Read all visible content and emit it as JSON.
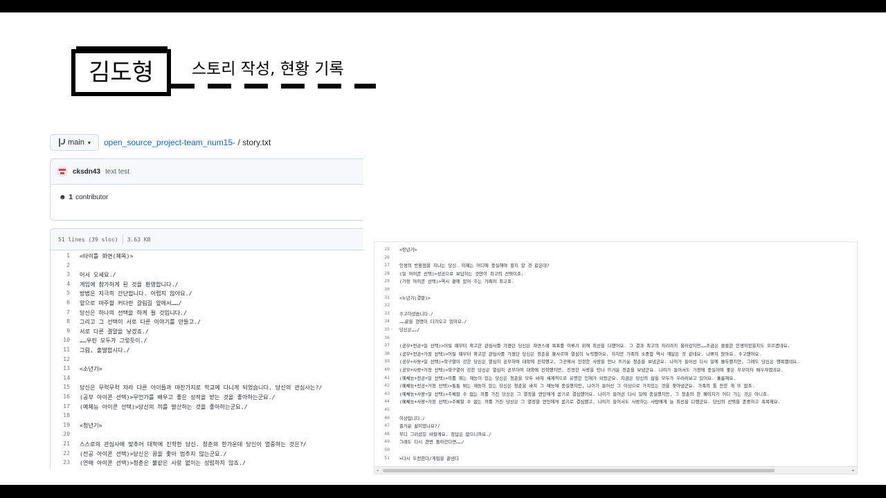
{
  "header": {
    "name": "김도형",
    "subtitle": "스토리 작성, 현황 기록"
  },
  "github": {
    "branch": "main",
    "repo_link": "open_source_project-team_num15-",
    "separator": "/",
    "file_name": "story.txt",
    "commit": {
      "author": "cksdn43",
      "message": "text test"
    },
    "contributors": {
      "count": "1",
      "label": "contributor"
    },
    "file_info": {
      "lines": "51 lines (39 sloc)",
      "size": "3.63 KB"
    },
    "code": [
      {
        "n": "1",
        "t": "<타이틀 화면(제목)>"
      },
      {
        "n": "2",
        "t": ""
      },
      {
        "n": "3",
        "t": "어서 오세요./"
      },
      {
        "n": "4",
        "t": "게임에 참가하게 된 것을 환영합니다./"
      },
      {
        "n": "5",
        "t": "방법은 지극히 간단합니다. 어렵지 않아요./"
      },
      {
        "n": "6",
        "t": "앞으로 마주할 커다란 갈림길 앞에서……/"
      },
      {
        "n": "7",
        "t": "당신은 하나의 선택을 하게 될 것입니다./"
      },
      {
        "n": "8",
        "t": "그리고 그 선택이 서로 다른 이야기를 만들고./"
      },
      {
        "n": "9",
        "t": "서로 다른 결말을 낳겠죠./"
      },
      {
        "n": "10",
        "t": "……우린 모두가 그렇듯이./"
      },
      {
        "n": "11",
        "t": "그럼, 출발합시다./"
      },
      {
        "n": "12",
        "t": ""
      },
      {
        "n": "13",
        "t": "<소년기>"
      },
      {
        "n": "14",
        "t": ""
      },
      {
        "n": "15",
        "t": "당신은 무럭무럭 자라 다른 아이들과 마찬가지로 학교에 다니게 되었습니다. 당신의 관심사는?/"
      },
      {
        "n": "16",
        "t": "(공부 아이콘 선택)>무언가를 배우고 좋은 성적을 받는 것을 좋아하는군요./"
      },
      {
        "n": "17",
        "t": "(예체능 아이콘 선택)>당신의 끼를 발산하는 것을 좋아하는군요./"
      },
      {
        "n": "18",
        "t": ""
      },
      {
        "n": "19",
        "t": "<청년기>"
      },
      {
        "n": "20",
        "t": ""
      },
      {
        "n": "21",
        "t": "스스로의 관심사에 맞추어 대학에 진학한 당신. 청춘의 한가운데 당신이 열중하는 것은?/"
      },
      {
        "n": "22",
        "t": "(전공 아이콘 선택)>당신은 꿈을 좇아 멈추지 않는군요./"
      },
      {
        "n": "23",
        "t": "(연애 아이콘 선택)>청춘은 불같은 사랑 없이는 성립하지 않죠./"
      }
    ]
  },
  "second_view": {
    "code": [
      {
        "n": "25",
        "t": "<장년기>"
      },
      {
        "n": "26",
        "t": ""
      },
      {
        "n": "27",
        "t": "인생의 반환점을 지나는 당신. 이제는 어디에 충실해야 할지 알 것 같은데?"
      },
      {
        "n": "28",
        "t": "(일 아이콘 선택)>성공으로 보답하는 것만이 최고의 선택이죠."
      },
      {
        "n": "29",
        "t": "(가정 아이콘 선택)>역시 곁에 있어 주는 가족이 최고죠."
      },
      {
        "n": "30",
        "t": ""
      },
      {
        "n": "31",
        "t": "<노년기(결말)>"
      },
      {
        "n": "32",
        "t": ""
      },
      {
        "n": "33",
        "t": "수고하셨습니다./"
      },
      {
        "n": "34",
        "t": "……끝을 현명이 다가오고 있어요./"
      },
      {
        "n": "35",
        "t": "당신은……/"
      },
      {
        "n": "36",
        "t": ""
      },
      {
        "n": "37",
        "t": "(공부+전공+일 선택)>어릴 때부터 확고한 관심사를 가졌던 당신은 자연스레 목표를 이루기 위해 최선을 다했어요. 그 결과 최고의 자리까지 올라갔지만……조금은 쓸쓸한 인생이었을지도 모르겠네요."
      },
      {
        "n": "38",
        "t": "(공부+전공+가정 선택)>어릴 때부터 확고한 관심사를 가졌던 당신은 청춘을 불사르며 열심히 노력했어요. 하지만 가족의 소중함 역시 깨달은 것 같네요. 나쁘지 않아요. 수고했어요."
      },
      {
        "n": "39",
        "t": "(공부+사랑+일 선택)>학구열이 강한 당신은 열심히 공부하여 대학에 진학했고, 그곳에서 진정한 사랑을 만나 뜨거운 청춘을 보냈군요. 나이가 들어선 다시 일에 몰두했지만, 그래도 당신은 행복했네요."
      },
      {
        "n": "40",
        "t": "(공부+사랑+가정 선택)>학구열이 강한 당신은 열심히 공부하여 대학에 진학했지만, 진정한 사랑을 만나 뜨거운 청춘을 보냈군요. 나이가 들어서도 가정에 충실하며 좋은 부모이자 배우자였네요."
      },
      {
        "n": "41",
        "t": "(예체능+전공+일 선택)>끼를 뛰는 재능이 있는 당신은 청춘을 모두 바쳐 세계적으로 유명한 인재가 되었군요. 지금은 당신의 삶을 모두가 우러러보고 있어요. 훌륭해요."
      },
      {
        "n": "42",
        "t": "(예체능+전공+가정 선택)>통통 튀는 재능이 있는 당신은 청춘을 바쳐 그 재능에 충실했지만, 나이가 들어선 그 이상으로 가치있는 것을 찾아냈군요. 가족의 틀 만한 게 또 없죠."
      },
      {
        "n": "43",
        "t": "(예체능+사랑+일 선택)>주체할 수 없는 끼를 가진 당신은 그 열정을 연인에게 쏟기로 결심했어요. 나이가 들어선 다시 일에 충실했지만, 그 청춘의 한 페이지가 어디 가는 것은 아니죠."
      },
      {
        "n": "44",
        "t": "(예체능+사랑+가정 선택)>주체할 수 없는 끼를 가진 당신은 그 열정을 연인에게 쏟기로 결심했고, 나이가 들어서도 사랑하는 사람에게 늘 최선을 다했군요. 당신의 선택을 존중하고 축복해요."
      },
      {
        "n": "45",
        "t": ""
      },
      {
        "n": "46",
        "t": "이상입니다./"
      },
      {
        "n": "47",
        "t": "즐거운 삶이었나요?/"
      },
      {
        "n": "48",
        "t": "부디 그러셨길 바랄게요. 정답은 없으니까요./"
      },
      {
        "n": "49",
        "t": "그래도 다시 한번 돌아간다면……/"
      },
      {
        "n": "50",
        "t": ""
      },
      {
        "n": "51",
        "t": ">다시 도전한다/게임을 끝낸다"
      }
    ]
  }
}
